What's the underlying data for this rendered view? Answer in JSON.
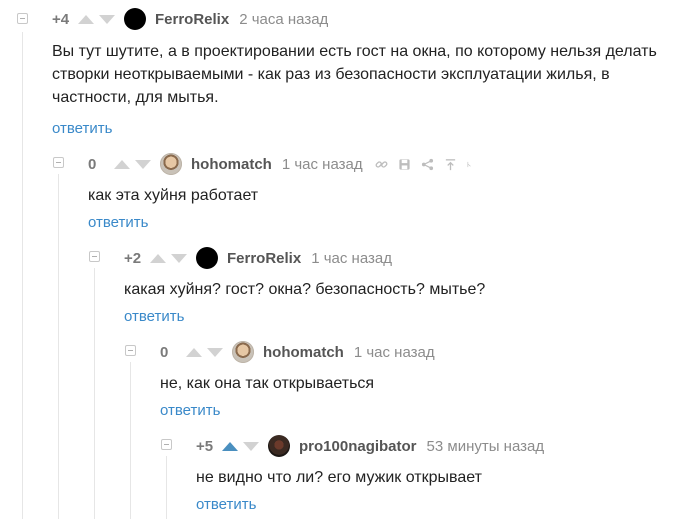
{
  "comments": [
    {
      "rating": "+4",
      "author": "FerroRelix",
      "time": "2 часа назад",
      "text": "Вы тут шутите, а в проектировании есть гост на окна, по которому нельзя делать створки неоткрываемыми - как раз из безопасности эксплуатации жилья, в частности, для мытья.",
      "reply": "ответить",
      "avatar": "black",
      "upvoted": false
    },
    {
      "rating": "0",
      "author": "hohomatch",
      "time": "1 час назад",
      "text": "как эта хуйня работает",
      "reply": "ответить",
      "avatar": "photo",
      "upvoted": false,
      "action_icons": [
        "link-icon",
        "save-icon",
        "share-icon",
        "upload-icon",
        "more-icon"
      ]
    },
    {
      "rating": "+2",
      "author": "FerroRelix",
      "time": "1 час назад",
      "text": "какая хуйня? гост? окна? безопасность? мытье?",
      "reply": "ответить",
      "avatar": "black",
      "upvoted": false
    },
    {
      "rating": "0",
      "author": "hohomatch",
      "time": "1 час назад",
      "text": "не, как она так открываеться",
      "reply": "ответить",
      "avatar": "photo",
      "upvoted": false
    },
    {
      "rating": "+5",
      "author": "pro100nagibator",
      "time": "53 минуты назад",
      "text": "не видно что ли? его мужик открывает",
      "reply": "ответить",
      "avatar": "dark",
      "upvoted": true
    }
  ],
  "colors": {
    "link": "#3a89c9",
    "vote_active": "#4a8fbf",
    "vote_inactive": "#d2d2d2"
  }
}
